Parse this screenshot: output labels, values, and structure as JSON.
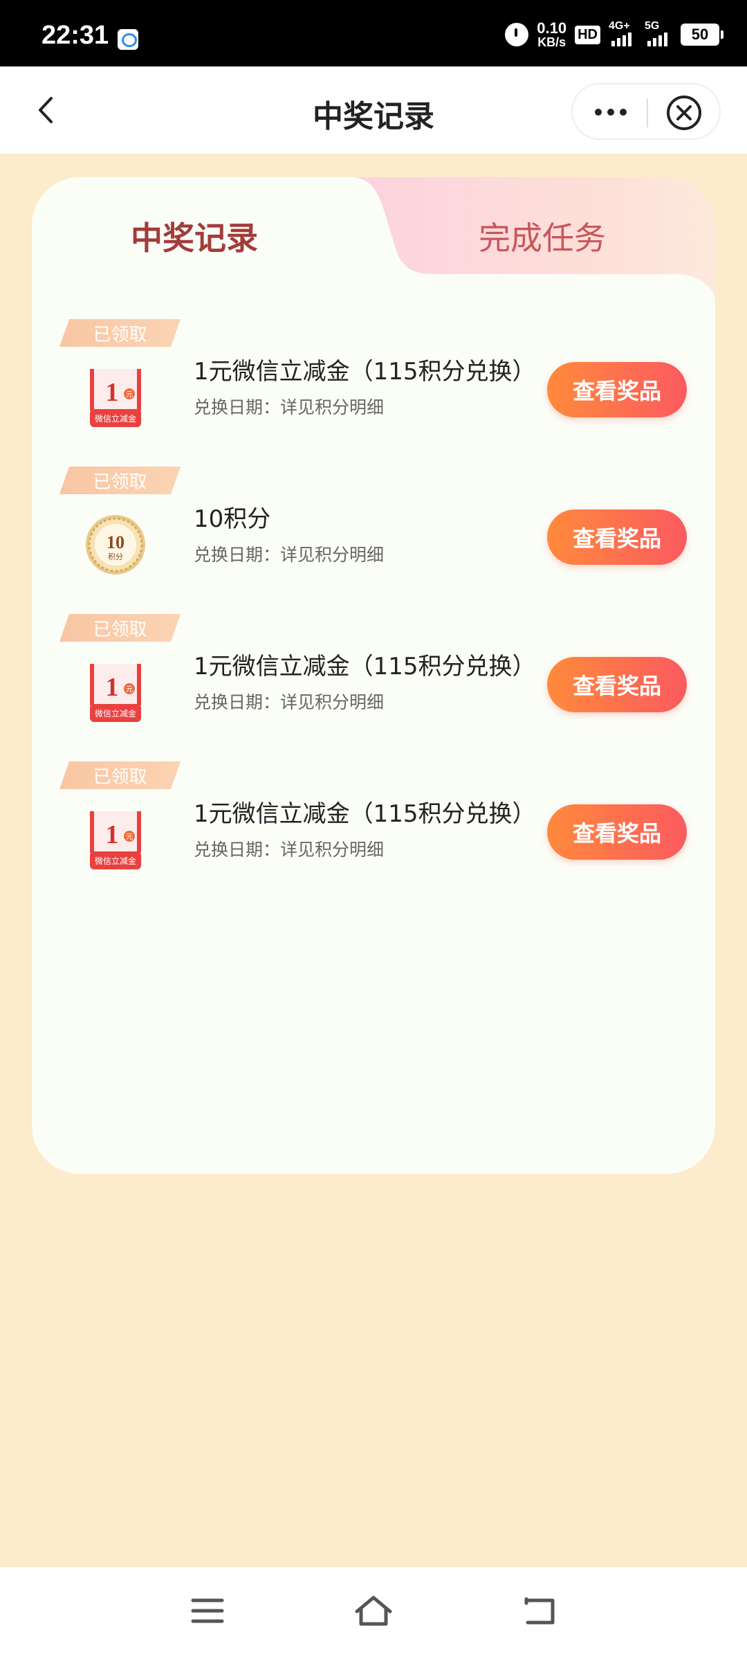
{
  "status_bar": {
    "time": "22:31",
    "net_speed_value": "0.10",
    "net_speed_unit": "KB/s",
    "hd_label": "HD",
    "signal1_label": "4G+",
    "signal2_label": "5G",
    "battery": "50"
  },
  "nav": {
    "title": "中奖记录"
  },
  "tabs": [
    {
      "label": "中奖记录",
      "active": true
    },
    {
      "label": "完成任务",
      "active": false
    }
  ],
  "records": [
    {
      "badge": "已领取",
      "icon": "wechat-coupon-icon",
      "name": "1元微信立减金（115积分兑换）",
      "date": "兑换日期：详见积分明细",
      "button": "查看奖品"
    },
    {
      "badge": "已领取",
      "icon": "points-coin-icon",
      "name": "10积分",
      "date": "兑换日期：详见积分明细",
      "button": "查看奖品"
    },
    {
      "badge": "已领取",
      "icon": "wechat-coupon-icon",
      "name": "1元微信立减金（115积分兑换）",
      "date": "兑换日期：详见积分明细",
      "button": "查看奖品"
    },
    {
      "badge": "已领取",
      "icon": "wechat-coupon-icon",
      "name": "1元微信立减金（115积分兑换）",
      "date": "兑换日期：详见积分明细",
      "button": "查看奖品"
    }
  ],
  "coupon_icon": {
    "amount": "1",
    "unit": "元",
    "caption": "微信立减金"
  },
  "coin_icon": {
    "amount": "10",
    "caption": "积分"
  },
  "colors": {
    "page_bg": "#fdeccb",
    "accent_button_start": "#ff8a3c",
    "accent_button_end": "#fb5a5f",
    "active_tab_text": "#a23c3a"
  }
}
